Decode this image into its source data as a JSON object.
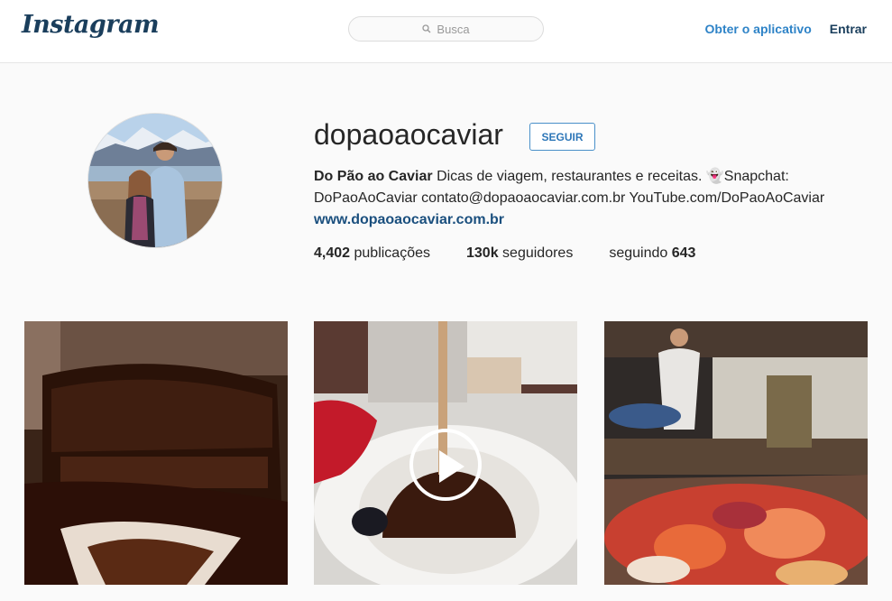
{
  "header": {
    "logo": "Instagram",
    "search_placeholder": "Busca",
    "get_app": "Obter o aplicativo",
    "login": "Entrar"
  },
  "profile": {
    "username": "dopaoaocaviar",
    "follow_label": "SEGUIR",
    "full_name": "Do Pão ao Caviar",
    "bio_line1": "Dicas de viagem, restaurantes e receitas. 👻Snapchat:",
    "bio_line2": "DoPaoAoCaviar contato@dopaoaocaviar.com.br YouTube.com/DoPaoAoCaviar",
    "website": "www.dopaoaocaviar.com.br",
    "posts_count": "4,402",
    "posts_label": "publicações",
    "followers_count": "130k",
    "followers_label": "seguidores",
    "following_label": "seguindo",
    "following_count": "643"
  },
  "colors": {
    "accent": "#3897f0",
    "link": "#1a4f7e",
    "background": "#fafafa"
  }
}
